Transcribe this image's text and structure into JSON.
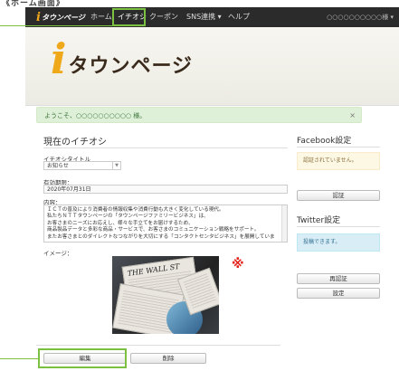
{
  "caption": "《ホーム画面》",
  "navbar": {
    "brand_logo": "タウンページ",
    "items": [
      {
        "label": "ホーム"
      },
      {
        "label": "イチオシ"
      },
      {
        "label": "クーポン"
      },
      {
        "label": "SNS連携 ▾"
      },
      {
        "label": "ヘルプ"
      }
    ],
    "account_label": "○○○○○○○○○○様 ▾"
  },
  "banner": {
    "logo_text": "タウンページ"
  },
  "welcome": {
    "message": "ようこそ、○○○○○○○○○○ 様。",
    "close": "×"
  },
  "main": {
    "section_title": "現在のイチオシ",
    "title_label": "イチオシタイトル",
    "title_value": "お知らせ",
    "period_label": "有効期限：",
    "period_value": "2020年07月31日",
    "content_label": "内容：",
    "content_lines": [
      "ＩＣＴの普及により消費者の情報収集や消費行動も大きく変化している現代。",
      "私たちＮＴＴタウンページの「タウンページファミリービジネス」は、",
      "お客さまのニーズにお応えし、様々な手立てをお届けするため、",
      "商品製品データと多彩な商品・サービスで、お客さまのコミュニケーション戦略をサポート。",
      "またお客さまとのダイレクトなつながりを大切にする「コンタクトセンタビジネス」を展開していま"
    ],
    "image_label": "イメージ：",
    "note_mark": "※",
    "edit_button": "編集",
    "delete_button": "削除"
  },
  "side": {
    "facebook_title": "Facebook設定",
    "facebook_status": "認証されていません。",
    "facebook_auth_button": "認証",
    "twitter_title": "Twitter設定",
    "twitter_status": "投稿できます。",
    "twitter_reauth_button": "再認証",
    "twitter_settings_button": "設定"
  },
  "colors": {
    "highlight": "#7cc042",
    "brand_accent": "#f0a81b",
    "note_red": "#e2231a",
    "navbar_bg": "#2b2b2b"
  }
}
